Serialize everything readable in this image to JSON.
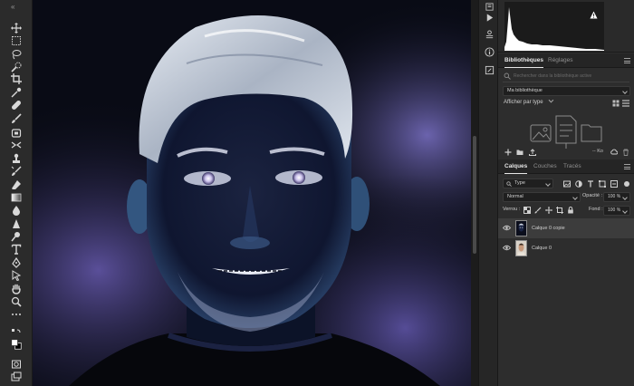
{
  "libraries_panel": {
    "tabs": [
      {
        "label": "Bibliothèques",
        "active": true
      },
      {
        "label": "Réglages",
        "active": false
      }
    ],
    "search_placeholder": "Rechercher dans la bibliothèque active",
    "library_select": "Ma bibliothèque",
    "view_label": "Afficher par type",
    "size_label": "-- Ko"
  },
  "layers_panel": {
    "tabs": [
      {
        "label": "Calques",
        "active": true
      },
      {
        "label": "Couches",
        "active": false
      },
      {
        "label": "Tracés",
        "active": false
      }
    ],
    "filter_select": "Type",
    "blend_mode": "Normal",
    "opacity_label": "Opacité :",
    "opacity_value": "100 %",
    "lock_label": "Verrou :",
    "fill_label": "Fond :",
    "fill_value": "100 %",
    "layers": [
      {
        "name": "Calque 0 copie",
        "selected": true,
        "visible": true
      },
      {
        "name": "Calque 0",
        "selected": false,
        "visible": true
      }
    ]
  },
  "toolbar": {
    "tools": [
      "move-tool",
      "marquee-tool",
      "lasso-tool",
      "quick-select-tool",
      "crop-tool",
      "eyedropper-tool",
      "healing-tool",
      "brush-tool",
      "stamp-tool",
      "history-brush-tool",
      "eraser-tool",
      "gradient-tool",
      "blur-tool",
      "dodge-tool",
      "pen-tool",
      "type-tool",
      "path-select-tool",
      "hand-tool",
      "zoom-tool",
      "more-tools"
    ]
  },
  "colors": {
    "panel_bg": "#2d2d2d",
    "toolbar_bg": "#2b2b2b",
    "selected_layer": "#3c3c3c",
    "text": "#cfcfcf"
  }
}
